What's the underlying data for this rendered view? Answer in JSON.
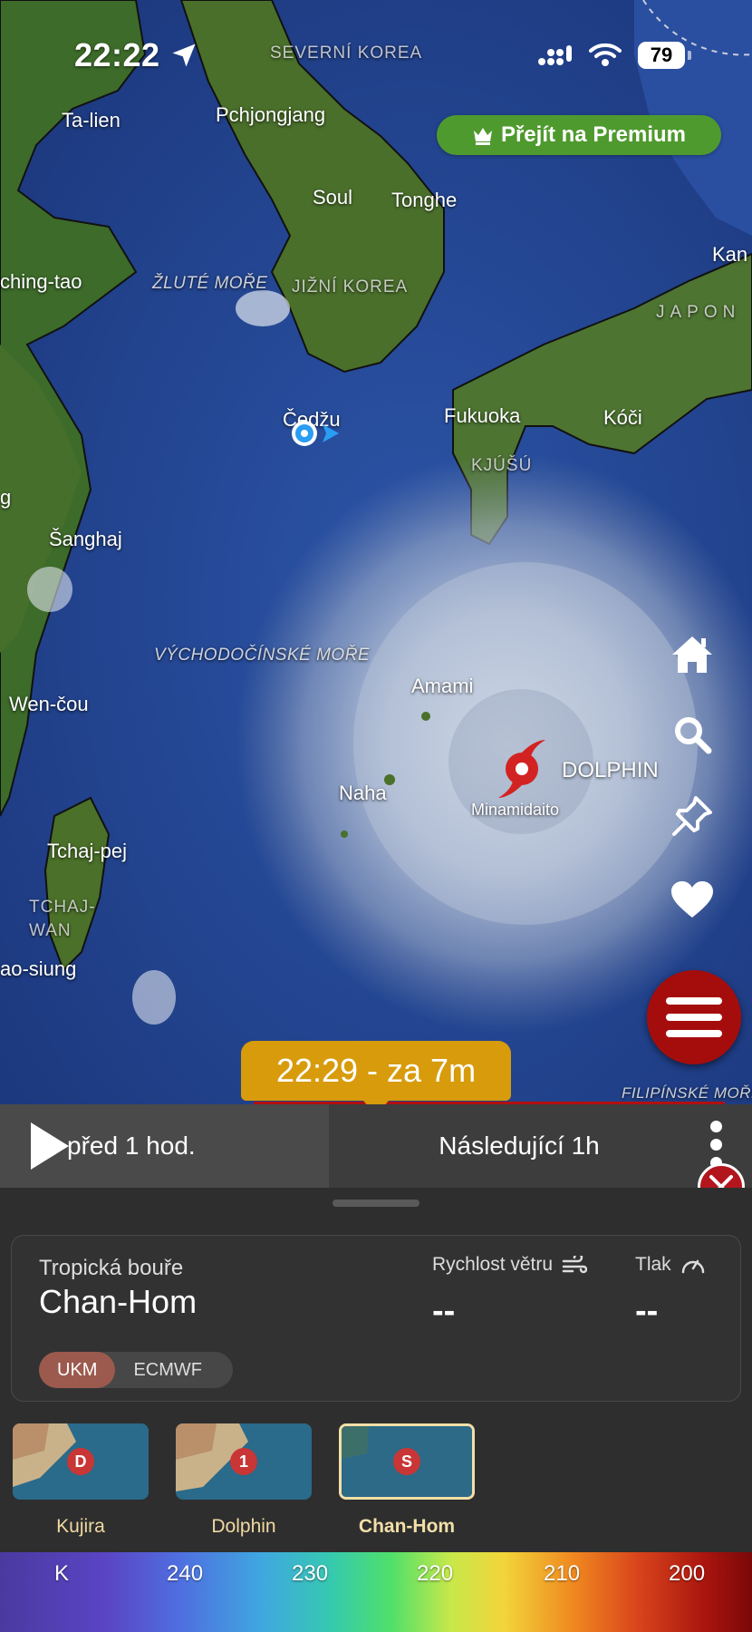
{
  "status_bar": {
    "time": "22:22",
    "battery": "79"
  },
  "premium_button": {
    "label": "Přejít na Premium"
  },
  "map_labels": {
    "severni_korea": "SEVERNÍ KOREA",
    "ta_lien": "Ta-lien",
    "pchjongjang": "Pchjongjang",
    "soul": "Soul",
    "tonghe": "Tonghe",
    "kan": "Kan",
    "ching_tao": "ching-tao",
    "zlute_more": "ŽLUTÉ MOŘE",
    "jizni_korea": "JIŽNÍ KOREA",
    "japon": "JAPON",
    "cedzu": "Čedžu",
    "fukuoka": "Fukuoka",
    "koci": "Kóči",
    "kjusu": "KJÚŠÚ",
    "g_edge": "g",
    "sanghaj": "Šanghaj",
    "vychodocinske_more": "VÝCHODOČÍNSKÉ MOŘE",
    "amami": "Amami",
    "wen_cou": "Wen-čou",
    "naha": "Naha",
    "tchaj_pej": "Tchaj-pej",
    "tchaj_wan": "TCHAJ-\nWAN",
    "ao_siung": "ao-siung",
    "filipinske_more": "FILIPÍNSKÉ MOŘE"
  },
  "storm_marker": {
    "name": "DOLPHIN",
    "place": "Minamidaito"
  },
  "time_bubble": {
    "label": "22:29 - za 7m"
  },
  "timeline": {
    "previous": "před 1 hod.",
    "next": "Následující 1h"
  },
  "storm_card": {
    "type": "Tropická bouře",
    "name": "Chan-Hom",
    "wind_label": "Rychlost větru",
    "wind_value": "--",
    "pressure_label": "Tlak",
    "pressure_value": "--",
    "models": [
      {
        "label": "UKM",
        "active": true
      },
      {
        "label": "ECMWF",
        "active": false
      }
    ]
  },
  "storm_list": [
    {
      "name": "Kujira",
      "badge": "D",
      "selected": false
    },
    {
      "name": "Dolphin",
      "badge": "1",
      "selected": false
    },
    {
      "name": "Chan-Hom",
      "badge": "S",
      "selected": true
    }
  ],
  "legend": {
    "ticks": [
      "K",
      "240",
      "230",
      "220",
      "210",
      "200"
    ]
  },
  "icons": {
    "location_arrow": "location-arrow-icon",
    "home": "home-icon",
    "search": "search-icon",
    "pin": "pin-icon",
    "favorite": "heart-icon",
    "menu": "menu-icon",
    "play": "play-icon",
    "close": "close-icon",
    "storm": "hurricane-icon",
    "wind": "wind-icon",
    "gauge": "gauge-icon",
    "crown": "crown-icon"
  },
  "colors": {
    "premium_green": "#4f9a2e",
    "accent_red": "#a50d0d",
    "time_bubble": "#d79b0c",
    "selected_storm": "#f3dfa8",
    "model_active": "#9b5a4d"
  }
}
